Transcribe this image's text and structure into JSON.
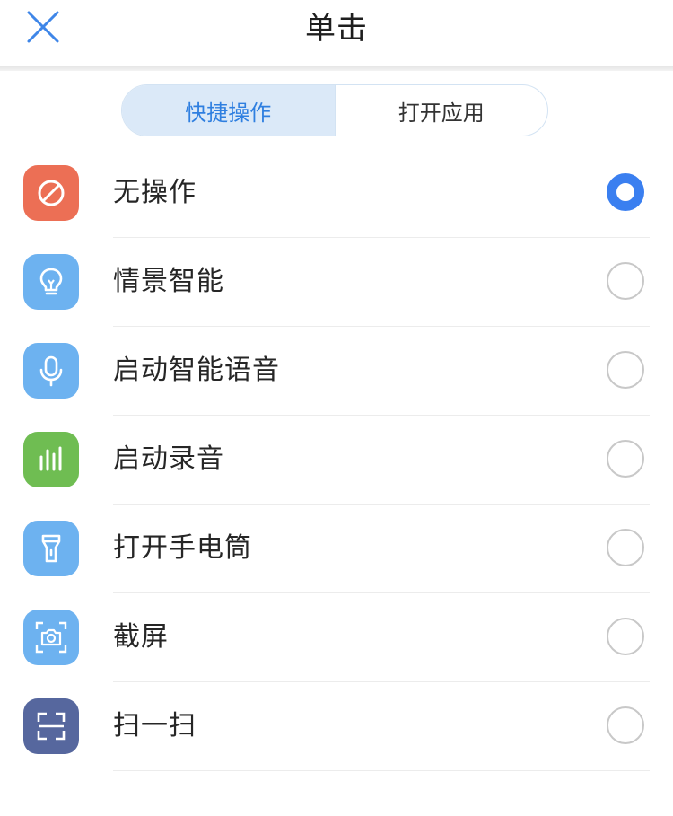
{
  "header": {
    "title": "单击"
  },
  "tabs": [
    {
      "label": "快捷操作",
      "active": true
    },
    {
      "label": "打开应用",
      "active": false
    }
  ],
  "options": [
    {
      "label": "无操作",
      "icon": "no-operation-icon",
      "color": "#ec6f55",
      "selected": true
    },
    {
      "label": "情景智能",
      "icon": "lightbulb-icon",
      "color": "#6db2f0",
      "selected": false
    },
    {
      "label": "启动智能语音",
      "icon": "microphone-icon",
      "color": "#6db2f0",
      "selected": false
    },
    {
      "label": "启动录音",
      "icon": "audio-bars-icon",
      "color": "#6fbd52",
      "selected": false
    },
    {
      "label": "打开手电筒",
      "icon": "flashlight-icon",
      "color": "#6db2f0",
      "selected": false
    },
    {
      "label": "截屏",
      "icon": "screenshot-camera-icon",
      "color": "#6db2f0",
      "selected": false
    },
    {
      "label": "扫一扫",
      "icon": "scan-icon",
      "color": "#56679e",
      "selected": false
    }
  ],
  "colors": {
    "accent": "#3a7ff0",
    "tab_active_bg": "#dbe9f8",
    "tab_active_text": "#2f7fe0"
  }
}
